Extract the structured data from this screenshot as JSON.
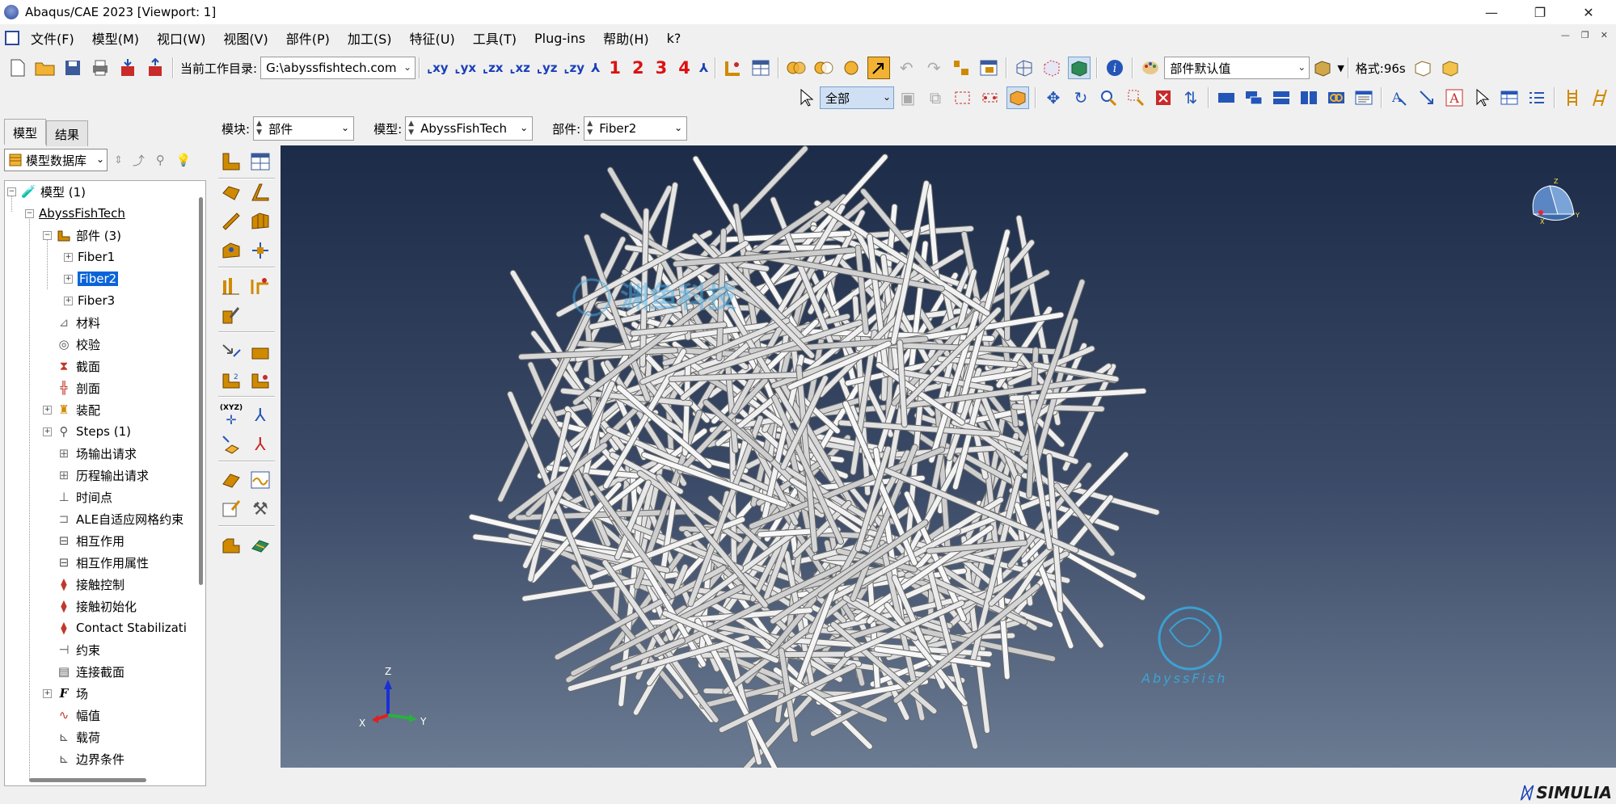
{
  "window": {
    "title": "Abaqus/CAE 2023 [Viewport: 1]"
  },
  "menubar": {
    "items": [
      "文件(F)",
      "模型(M)",
      "视口(W)",
      "视图(V)",
      "部件(P)",
      "加工(S)",
      "特征(U)",
      "工具(T)",
      "Plug-ins",
      "帮助(H)",
      "k?"
    ]
  },
  "toolbar1": {
    "workdir_label": "当前工作目录:",
    "workdir_value": "G:\\abyssfishtech.com",
    "view_numbers": [
      "1",
      "2",
      "3",
      "4"
    ],
    "render_style_value": "部件默认值",
    "format_label": "格式:96s"
  },
  "toolbar2": {
    "selection_filter": "全部"
  },
  "context": {
    "module_label": "模块:",
    "module_value": "部件",
    "model_label": "模型:",
    "model_value": "AbyssFishTech",
    "part_label": "部件:",
    "part_value": "Fiber2"
  },
  "leftpanel": {
    "tabs": [
      "模型",
      "结果"
    ],
    "db_combo": "模型数据库",
    "tree": [
      "模型 (1)",
      "AbyssFishTech",
      "部件 (3)",
      "Fiber1",
      "Fiber2",
      "Fiber3",
      "材料",
      "校验",
      "截面",
      "剖面",
      "装配",
      "Steps (1)",
      "场输出请求",
      "历程输出请求",
      "时间点",
      "ALE自适应网格约束",
      "相互作用",
      "相互作用属性",
      "接触控制",
      "接触初始化",
      "Contact Stabilizati",
      "约束",
      "连接截面",
      "场",
      "幅值",
      "载荷",
      "边界条件"
    ]
  },
  "viewport": {
    "triad": {
      "z": "Z",
      "x": "X",
      "y": "Y"
    },
    "watermark_text": "渊鱼科技",
    "watermark_brand": "AbyssFish"
  },
  "brand": "SIMULIA"
}
